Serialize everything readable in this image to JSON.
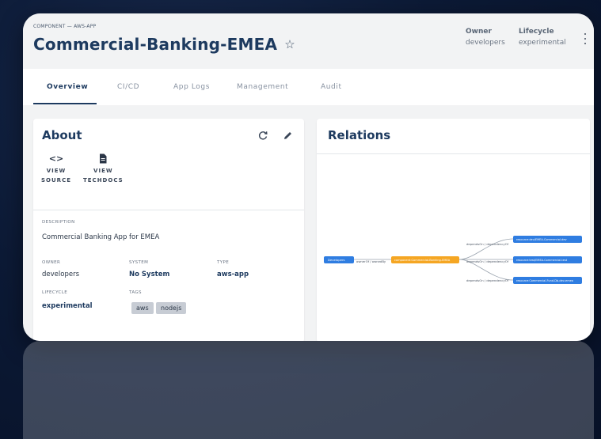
{
  "header": {
    "kind": "COMPONENT — AWS-APP",
    "title": "Commercial-Banking-EMEA",
    "star_icon": "☆",
    "owner_label": "Owner",
    "owner_value": "developers",
    "lifecycle_label": "Lifecycle",
    "lifecycle_value": "experimental"
  },
  "tabs": [
    "Overview",
    "CI/CD",
    "App Logs",
    "Management",
    "Audit"
  ],
  "active_tab": "Overview",
  "about": {
    "title": "About",
    "links": [
      {
        "icon": "code-icon",
        "glyph": "<>",
        "line1": "VIEW",
        "line2": "SOURCE"
      },
      {
        "icon": "document-icon",
        "glyph": "🗎",
        "line1": "VIEW",
        "line2": "TECHDOCS"
      }
    ],
    "description_label": "DESCRIPTION",
    "description": "Commercial Banking App for EMEA",
    "owner_label": "OWNER",
    "owner": "developers",
    "system_label": "SYSTEM",
    "system": "No System",
    "type_label": "TYPE",
    "type": "aws-app",
    "lifecycle_label": "LIFECYCLE",
    "lifecycle": "experimental",
    "tags_label": "TAGS",
    "tags": [
      "aws",
      "nodejs"
    ]
  },
  "relations": {
    "title": "Relations",
    "nodes": {
      "group": "Developers",
      "center": "component:Commercial-Banking-EMEA",
      "targets": [
        "resource:dev/EMEA-Commercial-dev",
        "resource:test/EMEA-Commercial-test",
        "resource:Commercial-Fund-Db-dev-emea"
      ]
    },
    "edges": {
      "owner": "ownerOf / ownedBy",
      "dependency": "dependsOn / dependencyOf"
    }
  },
  "colors": {
    "primary": "#1d3a5f",
    "node_blue": "#2f7de1",
    "node_orange": "#f5a623",
    "tag_bg": "#c7ccd4"
  }
}
